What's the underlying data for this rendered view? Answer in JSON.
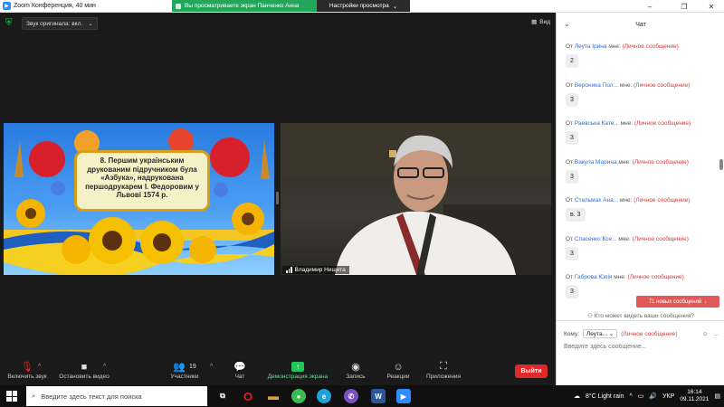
{
  "titlebar": {
    "app_title": "Zoom Конференция, 40 мин",
    "share_banner": "Вы просматриваете экран Панченко Анна",
    "view_options": "Настройки просмотра"
  },
  "meeting": {
    "original_sound": "Звук оригинала: вкл.",
    "view_label": "Вид",
    "slide_text": "8. Першим українським друкованим підручником була «Азбука», надрукована першодрукарем І. Федоровим у Львові 1574 р.",
    "speaker_name": "Владимир Нищета"
  },
  "toolbar": {
    "unmute": "Включить звук",
    "stop_video": "Остановить видео",
    "participants": "Участники",
    "participants_count": "19",
    "chat": "Чат",
    "share_screen": "Демонстрация экрана",
    "record": "Запись",
    "reactions": "Реакции",
    "apps": "Приложения",
    "leave": "Выйти"
  },
  "chat": {
    "title": "Чат",
    "from_prefix": "От",
    "to_me": "мне:",
    "private_label": "(Личное сообщение)",
    "messages": [
      {
        "sender": "Леута Ірина",
        "text": "2"
      },
      {
        "sender": "Вероника Пол...",
        "text": "3"
      },
      {
        "sender": "Раевська Кате...",
        "text": "3"
      },
      {
        "sender": "Вакула Марина",
        "text": "3"
      },
      {
        "sender": "Стельмах Ана...",
        "text": "в. 3"
      },
      {
        "sender": "Спасенко Ксе...",
        "text": "3"
      },
      {
        "sender": "Габрова Юлія",
        "text": "3"
      }
    ],
    "new_messages": "71 новых сообщений",
    "who_can_see": "Кто может видеть ваши сообщения?",
    "to_label": "Кому:",
    "to_value": "Леута...",
    "input_placeholder": "Введите здесь сообщение..."
  },
  "taskbar": {
    "search_placeholder": "Введите здесь текст для поиска",
    "weather": "8°C  Light rain",
    "language": "УКР",
    "time": "16:14",
    "date": "09.11.2021"
  },
  "colors": {
    "zoom_blue": "#2d8cff",
    "share_green": "#23a55a",
    "leave_red": "#e02828",
    "private_red": "#d23a3a",
    "new_msgs_red": "#e05858"
  }
}
